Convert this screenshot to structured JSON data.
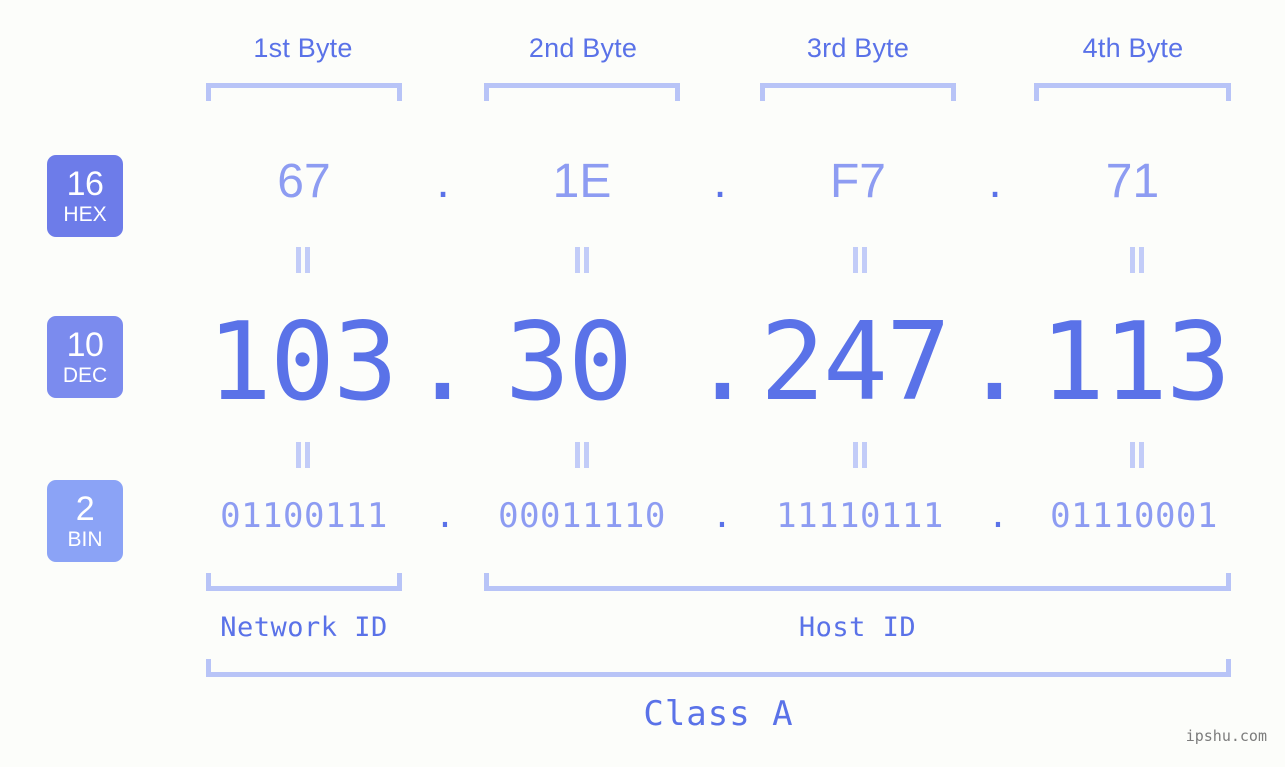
{
  "watermark": "ipshu.com",
  "columns": [
    {
      "header": "1st Byte"
    },
    {
      "header": "2nd Byte"
    },
    {
      "header": "3rd Byte"
    },
    {
      "header": "4th Byte"
    }
  ],
  "rows": {
    "hex": {
      "badge_num": "16",
      "badge_sub": "HEX",
      "badge_color": "#6d7ce9",
      "values": [
        "67",
        "1E",
        "F7",
        "71"
      ],
      "separator": "."
    },
    "dec": {
      "badge_num": "10",
      "badge_sub": "DEC",
      "badge_color": "#7b8bee",
      "values": [
        "103",
        "30",
        "247",
        "113"
      ],
      "separator": "."
    },
    "bin": {
      "badge_num": "2",
      "badge_sub": "BIN",
      "badge_color": "#8ba3f6",
      "values": [
        "01100111",
        "00011110",
        "11110111",
        "01110001"
      ],
      "separator": "."
    }
  },
  "footer": {
    "network_id": "Network ID",
    "host_id": "Host ID",
    "class": "Class A"
  },
  "colors": {
    "background": "#fcfdfa",
    "accent_strong": "#5a72e8",
    "accent_light": "#8d9cf2",
    "bracket": "#b8c4f7",
    "connector": "#c2ccf8",
    "watermark": "#7c7c7c"
  },
  "chart_data": {
    "type": "table",
    "title": "IP address 103.30.247.113 byte breakdown",
    "categories": [
      "1st Byte",
      "2nd Byte",
      "3rd Byte",
      "4th Byte"
    ],
    "series": [
      {
        "name": "HEX (base 16)",
        "values": [
          "67",
          "1E",
          "F7",
          "71"
        ]
      },
      {
        "name": "DEC (base 10)",
        "values": [
          103,
          30,
          247,
          113
        ]
      },
      {
        "name": "BIN (base 2)",
        "values": [
          "01100111",
          "00011110",
          "11110111",
          "01110001"
        ]
      }
    ],
    "annotations": {
      "network_id_span": [
        "1st Byte"
      ],
      "host_id_span": [
        "2nd Byte",
        "3rd Byte",
        "4th Byte"
      ],
      "class": "Class A"
    }
  }
}
